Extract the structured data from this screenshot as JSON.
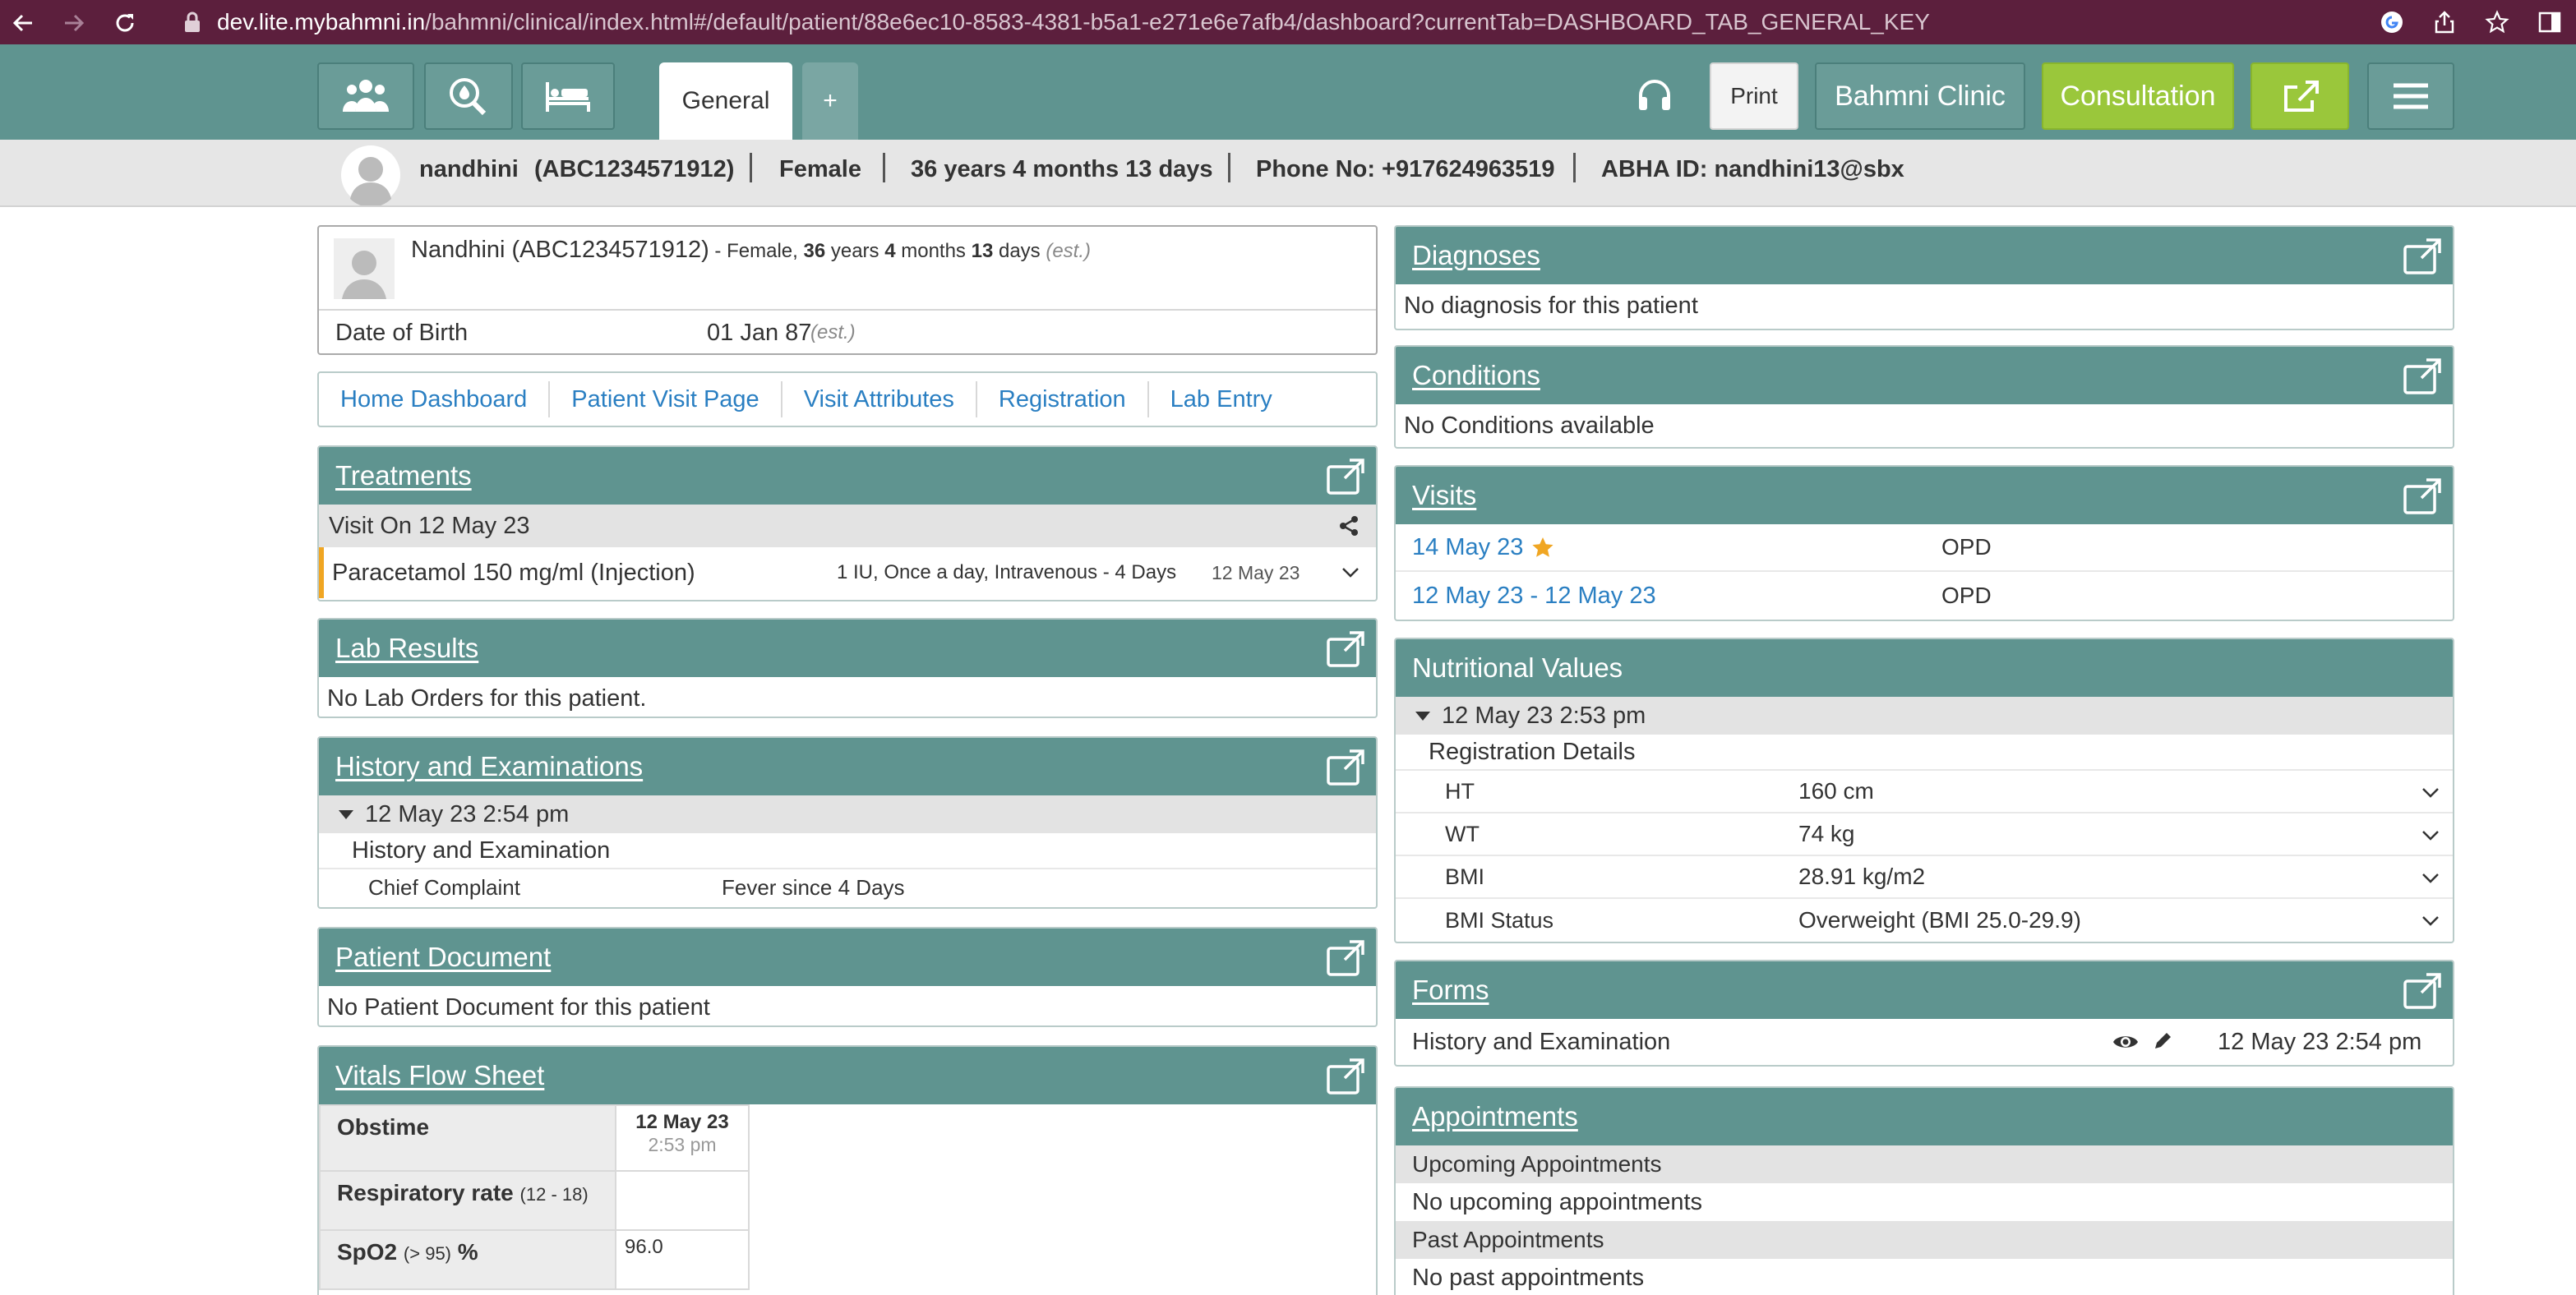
{
  "browser": {
    "url_host": "dev.lite.mybahmni.in",
    "url_path": "/bahmni/clinical/index.html#/default/patient/88e6ec10-8583-4381-b5a1-e271e6e7afb4/dashboard?currentTab=DASHBOARD_TAB_GENERAL_KEY",
    "icons": [
      "back-icon",
      "forward-icon",
      "reload-icon",
      "lock-icon",
      "google-icon",
      "share-icon",
      "star-icon",
      "sidebar-icon"
    ]
  },
  "header": {
    "tabs": [
      {
        "label": "General"
      },
      {
        "label": "+"
      }
    ],
    "print_label": "Print",
    "clinic_label": "Bahmni Clinic",
    "consultation_label": "Consultation",
    "icons": [
      "patients-icon",
      "search-patient-icon",
      "bed-icon",
      "headset-icon",
      "external-link-icon",
      "hamburger-menu-icon"
    ]
  },
  "patient_bar": {
    "name": "nandhini",
    "id": "(ABC1234571912)",
    "gender": "Female",
    "age": "36 years 4 months 13 days",
    "phone": "Phone No: +917624963519",
    "abha": "ABHA ID: nandhini13@sbx"
  },
  "patient_card": {
    "name": "Nandhini (ABC1234571912)",
    "gender_prefix": " - Female, ",
    "age_years": "36",
    "years_word": " years ",
    "age_months": "4",
    "months_word": " months ",
    "age_days": "13",
    "days_word": " days ",
    "est": "(est.)",
    "dob_label": "Date of Birth",
    "dob_value": "01 Jan 87",
    "dob_est": "(est.)"
  },
  "links": [
    "Home Dashboard",
    "Patient Visit Page",
    "Visit Attributes",
    "Registration",
    "Lab Entry"
  ],
  "treatments": {
    "title": "Treatments",
    "visit": "Visit On 12 May 23",
    "drug": "Paracetamol 150 mg/ml (Injection)",
    "dosage": "1 IU, Once a day, Intravenous - 4 Days",
    "date": "12 May 23"
  },
  "lab_results": {
    "title": "Lab Results",
    "empty": "No Lab Orders for this patient."
  },
  "history": {
    "title": "History and Examinations",
    "date": "12 May 23 2:54 pm",
    "form": "History and Examination",
    "field": "Chief Complaint",
    "value": "Fever since 4 Days"
  },
  "patient_document": {
    "title": "Patient Document",
    "empty": "No Patient Document for this patient"
  },
  "vitals": {
    "title": "Vitals Flow Sheet",
    "rows": [
      {
        "label": "Obstime",
        "range": "",
        "unit": "",
        "value": "12 May 23",
        "sub": "2:53 pm"
      },
      {
        "label": "Respiratory rate",
        "range": "(12 - 18)",
        "unit": "",
        "value": "",
        "sub": ""
      },
      {
        "label": "SpO2",
        "range": "(> 95)",
        "unit": "%",
        "value": "96.0",
        "sub": ""
      }
    ]
  },
  "diagnoses": {
    "title": "Diagnoses",
    "empty": "No diagnosis for this patient"
  },
  "conditions": {
    "title": "Conditions",
    "empty": "No Conditions available"
  },
  "visits": {
    "title": "Visits",
    "rows": [
      {
        "date": "14 May 23",
        "type": "OPD"
      },
      {
        "date": "12 May 23 - 12 May 23",
        "type": "OPD"
      }
    ]
  },
  "nutritional": {
    "title": "Nutritional Values",
    "date": "12 May 23 2:53 pm",
    "section": "Registration Details",
    "rows": [
      {
        "label": "HT",
        "value": "160 cm"
      },
      {
        "label": "WT",
        "value": "74 kg"
      },
      {
        "label": "BMI",
        "value": "28.91 kg/m2"
      },
      {
        "label": "BMI Status",
        "value": "Overweight (BMI 25.0-29.9)"
      }
    ]
  },
  "forms": {
    "title": "Forms",
    "name": "History and Examination",
    "date": "12 May 23 2:54 pm"
  },
  "appointments": {
    "title": "Appointments",
    "upcoming_label": "Upcoming Appointments",
    "upcoming_empty": "No upcoming appointments",
    "past_label": "Past Appointments",
    "past_empty": "No past appointments"
  },
  "colors": {
    "header": "#5f9490",
    "consultation": "#9ac73b",
    "browser": "#5c1f3d",
    "link": "#2a7fc2",
    "star": "#f0a623"
  }
}
